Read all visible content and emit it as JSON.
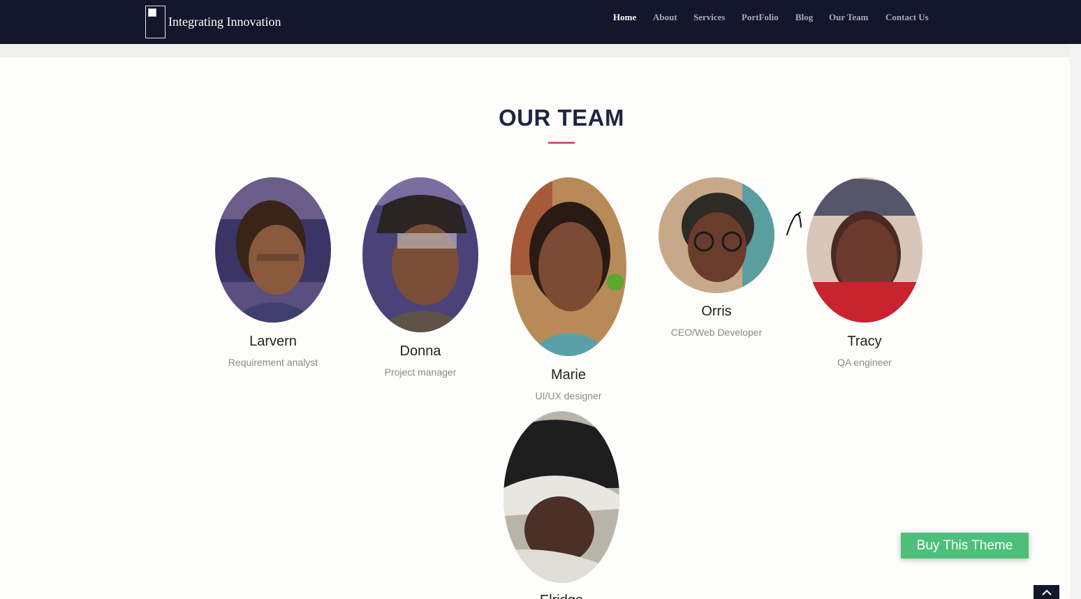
{
  "nav": {
    "brand": "Integrating Innovation",
    "links": [
      {
        "label": "Home",
        "active": true
      },
      {
        "label": "About"
      },
      {
        "label": "Services"
      },
      {
        "label": "PortFolio"
      },
      {
        "label": "Blog"
      },
      {
        "label": "Our Team"
      },
      {
        "label": "Contact Us"
      }
    ]
  },
  "team": {
    "title": "OUR TEAM",
    "members": [
      {
        "name": "Larvern",
        "role": "Requirement analyst"
      },
      {
        "name": "Donna",
        "role": "Project manager"
      },
      {
        "name": "Marie",
        "role": "UI/UX designer"
      },
      {
        "name": "Orris",
        "role": "CEO/Web Developer"
      },
      {
        "name": "Tracy",
        "role": "QA engineer"
      },
      {
        "name": "Elridge",
        "role": ""
      }
    ]
  },
  "buy_button": "Buy This Theme",
  "colors": {
    "navbar": "#14162c",
    "accent_underline": "#d9546a",
    "buy_button": "#4cc07a"
  }
}
